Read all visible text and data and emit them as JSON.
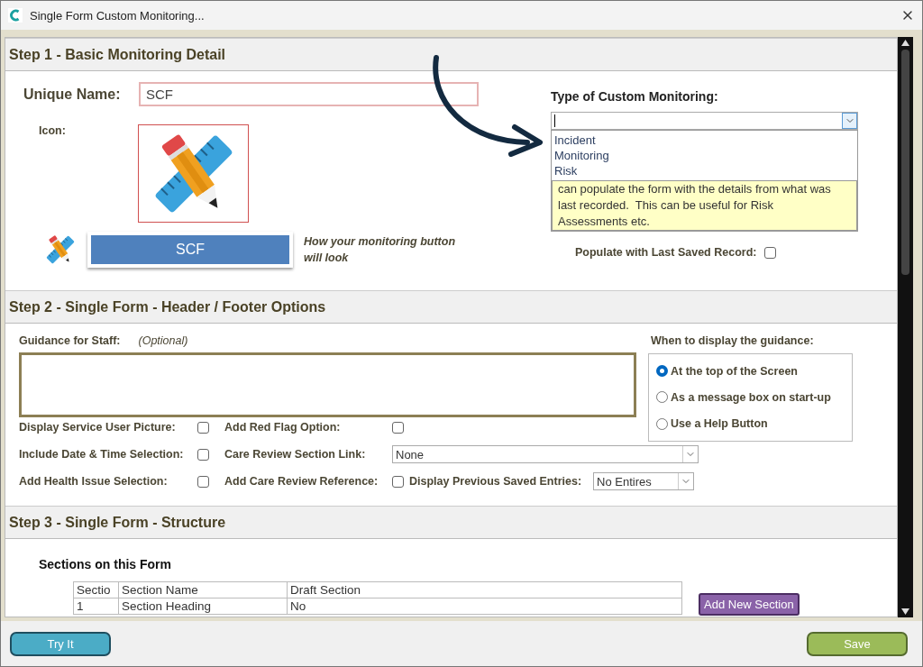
{
  "window": {
    "title": "Single Form Custom Monitoring..."
  },
  "step1": {
    "heading": "Step 1 - Basic Monitoring Detail",
    "unique_name": {
      "label": "Unique Name:",
      "value": "SCF"
    },
    "icon_label": "Icon:",
    "preview": {
      "button_label": "SCF",
      "caption": "How your monitoring button will look"
    },
    "type": {
      "label": "Type of Custom Monitoring:",
      "expanded": true,
      "options": [
        {
          "label": "Incident",
          "selected": false
        },
        {
          "label": "Monitoring",
          "selected": false
        },
        {
          "label": "Risk",
          "selected": false
        }
      ]
    },
    "info": "can populate the form with the details from what was last recorded.  This can be useful for Risk Assessments etc.",
    "populate": {
      "label": "Populate with Last Saved Record:",
      "checked": false
    }
  },
  "step2": {
    "heading": "Step 2 - Single Form - Header / Footer Options",
    "guidance": {
      "label": "Guidance for Staff:",
      "hint": "(Optional)"
    },
    "display_when": {
      "label": "When to display the guidance:",
      "options": [
        {
          "label": "At the top of the Screen",
          "selected": true
        },
        {
          "label": "As a message box on start-up",
          "selected": false
        },
        {
          "label": "Use a Help Button",
          "selected": false
        }
      ]
    },
    "rows": [
      [
        {
          "kind": "checkbox",
          "label": "Display Service User Picture:",
          "checked": false
        },
        {
          "kind": "checkbox",
          "label": "Add Red Flag Option:",
          "checked": false
        }
      ],
      [
        {
          "kind": "checkbox",
          "label": "Include Date & Time Selection:",
          "checked": false
        },
        {
          "kind": "select",
          "label": "Care Review Section Link:",
          "value": "None"
        }
      ],
      [
        {
          "kind": "checkbox",
          "label": "Add Health Issue Selection:",
          "checked": false
        },
        {
          "kind": "checkbox",
          "label": "Add Care Review Reference:",
          "checked": false
        },
        {
          "kind": "select",
          "label": "Display Previous Saved Entries:",
          "value": "No Entires"
        }
      ]
    ]
  },
  "step3": {
    "heading": "Step 3 - Single Form - Structure",
    "subheading": "Sections on this Form",
    "table": {
      "columns": [
        "Sectio",
        "Section Name",
        "Draft Section"
      ],
      "rows": [
        [
          "1",
          "Section Heading",
          "No"
        ]
      ]
    },
    "add_button": "Add New Section"
  },
  "footer": {
    "buttons": [
      {
        "label": "Try It",
        "kind": "secondary"
      },
      {
        "label": "Save",
        "kind": "primary"
      }
    ]
  }
}
